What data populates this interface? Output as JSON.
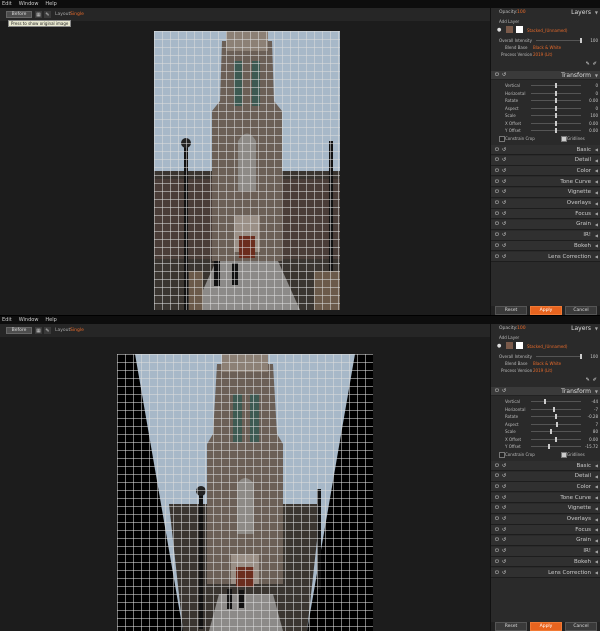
{
  "colors": {
    "accent": "#e86a2a",
    "panel": "#2a2a2a"
  },
  "menu": [
    "Edit",
    "Window",
    "Help"
  ],
  "toolbar": {
    "before_label": "Before",
    "layout_label": "Layout:",
    "layout_value": "Single"
  },
  "tooltip": "Press to show original image",
  "panel": {
    "opacity_label": "Opacity:",
    "opacity_value": "100",
    "layers_title": "Layers",
    "add_layer": "Add Layer",
    "layer_name": "Stacked_(Unnamed)",
    "overall_intensity_label": "Overall Intensity",
    "overall_intensity_value": "100",
    "blend_base_label": "Blend Base",
    "blend_base_value": "Black & White",
    "process_version_label": "Process Version",
    "process_version_value": "2019 (Lit)",
    "transform_title": "Transform",
    "slider_labels": [
      "Vertical",
      "Horizontal",
      "Rotate",
      "Aspect",
      "Scale",
      "X Offset",
      "Y Offset"
    ],
    "constrain_crop": "Constrain Crop",
    "gridlines": "Gridlines",
    "sections": [
      "Basic",
      "Detail",
      "Color",
      "Tone Curve",
      "Vignette",
      "Overlays",
      "Focus",
      "Grain",
      "IR!",
      "Bokeh",
      "Lens Correction"
    ],
    "reset": "Reset",
    "apply": "Apply",
    "cancel": "Cancel"
  },
  "states": [
    {
      "slider_values": [
        "0",
        "0",
        "0.00",
        "0",
        "100",
        "0.00",
        "0.00"
      ],
      "slider_levels": [
        0.5,
        0.5,
        0.5,
        0.5,
        0.5,
        0.5,
        0.5
      ]
    },
    {
      "slider_values": [
        "-44",
        "-7",
        "-0.28",
        "7",
        "80",
        "0.00",
        "-15.72"
      ],
      "slider_levels": [
        0.28,
        0.46,
        0.49,
        0.53,
        0.4,
        0.5,
        0.35
      ]
    }
  ]
}
